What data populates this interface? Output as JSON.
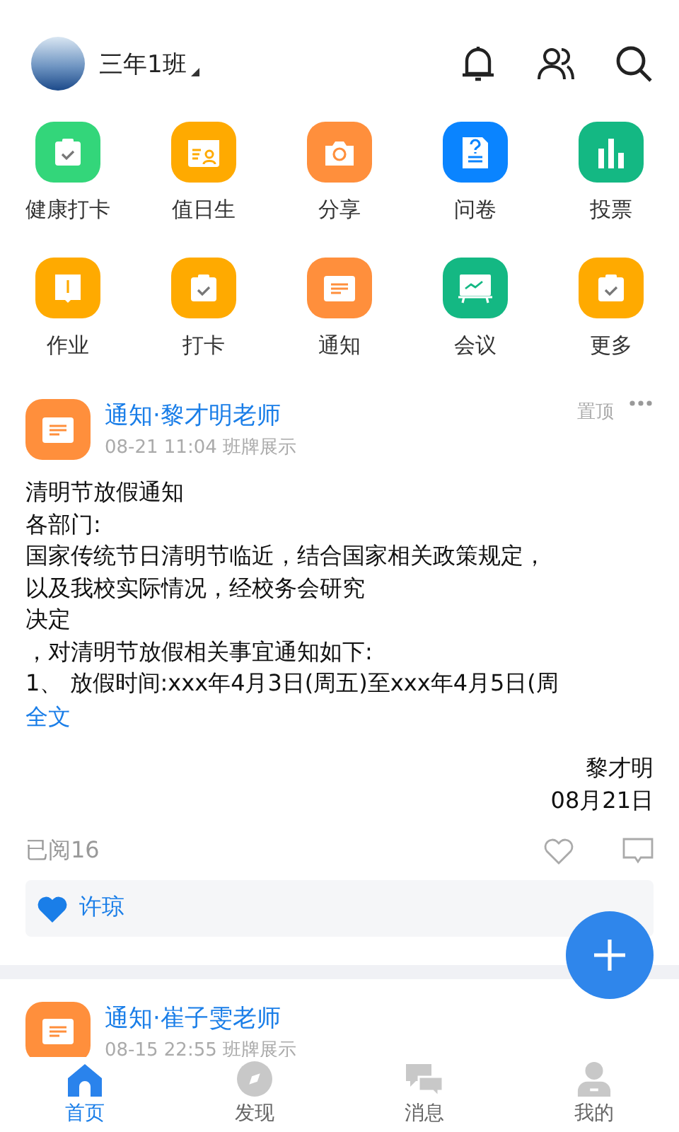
{
  "header": {
    "class_name": "三年1班"
  },
  "apps": [
    {
      "label": "健康打卡",
      "kind": "clipcheck",
      "color": "#33d67a"
    },
    {
      "label": "值日生",
      "kind": "duty",
      "color": "#ffaa00"
    },
    {
      "label": "分享",
      "kind": "camera",
      "color": "#ff8f3c"
    },
    {
      "label": "问卷",
      "kind": "survey",
      "color": "#0a84ff"
    },
    {
      "label": "投票",
      "kind": "bars",
      "color": "#14b883"
    },
    {
      "label": "作业",
      "kind": "homework",
      "color": "#ffaa00"
    },
    {
      "label": "打卡",
      "kind": "clipcheck",
      "color": "#ffaa00"
    },
    {
      "label": "通知",
      "kind": "notice",
      "color": "#ff8f3c"
    },
    {
      "label": "会议",
      "kind": "meeting",
      "color": "#14b883"
    },
    {
      "label": "更多",
      "kind": "clipcheck",
      "color": "#ffaa00"
    }
  ],
  "posts": [
    {
      "title": "通知·黎才明老师",
      "meta": "08-21 11:04 班牌展示",
      "pin": "置顶",
      "body": [
        "清明节放假通知",
        "各部门:",
        "国家传统节日清明节临近，结合国家相关政策规定，",
        "以及我校实际情况，经校务会研究",
        "决定",
        "，对清明节放假相关事宜通知如下:",
        "1、 放假时间:xxx年4月3日(周五)至xxx年4月5日(周"
      ],
      "more": "全文",
      "signature": "黎才明",
      "date": "08月21日",
      "read": "已阅16",
      "likers": "许琼"
    },
    {
      "title": "通知·崔子雯老师",
      "meta": "08-15 22:55 班牌展示"
    }
  ],
  "tabs": [
    {
      "label": "首页",
      "selected": true,
      "kind": "home"
    },
    {
      "label": "发现",
      "selected": false,
      "kind": "compass"
    },
    {
      "label": "消息",
      "selected": false,
      "kind": "chat"
    },
    {
      "label": "我的",
      "selected": false,
      "kind": "person"
    }
  ]
}
